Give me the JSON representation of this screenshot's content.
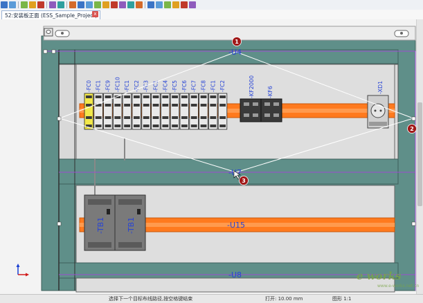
{
  "toolbar": {
    "icons": [
      "report-icon",
      "report-alt-icon",
      "undo-icon",
      "redo-icon",
      "undo-arrow-icon",
      "graph-icon",
      "macro-icon",
      "placement-icon",
      "box-icon",
      "component-icon",
      "terminal-icon",
      "wire-icon",
      "duct-icon",
      "cable-icon",
      "list-icon",
      "rail-icon",
      "align-icon",
      "grid-icon",
      "palette-icon",
      "mount-icon",
      "ruler-icon",
      "settings-icon"
    ]
  },
  "tab": {
    "title": "52:安装板正面 (ESS_Sample_Project)",
    "close_label": "x"
  },
  "canvas": {
    "fuses": [
      "-FC0",
      "-FC1",
      "-FC9",
      "-FC10",
      "-FC1",
      "-FC2",
      "-FC3",
      "-FC1",
      "-FC4",
      "-FC5",
      "-FC6",
      "-FC7",
      "-FC8",
      "-FC1",
      "-FC2"
    ],
    "relay1": "-KF2000",
    "relay2": "-KF6",
    "xd_label": "-XD1",
    "tb1_a": "-TB1",
    "tb1_b": "-TB1",
    "u4": "-U4",
    "u7": "-U7",
    "u15": "-U15",
    "u8": "-U8",
    "markers": [
      "1",
      "2",
      "3"
    ],
    "colors": {
      "panel": "#5f8f89",
      "rail": "#ff7a1e",
      "label": "#2643d6",
      "guide": "#9c4bd1",
      "marker": "#a01818"
    }
  },
  "status": {
    "prompt": "选择下一个目标布线路径,按空格键结束",
    "open": "打开: 10.00 mm",
    "scale": "图形 1:1"
  },
  "watermark": {
    "brand": "e works",
    "site": "www.e-works.net.cn"
  }
}
